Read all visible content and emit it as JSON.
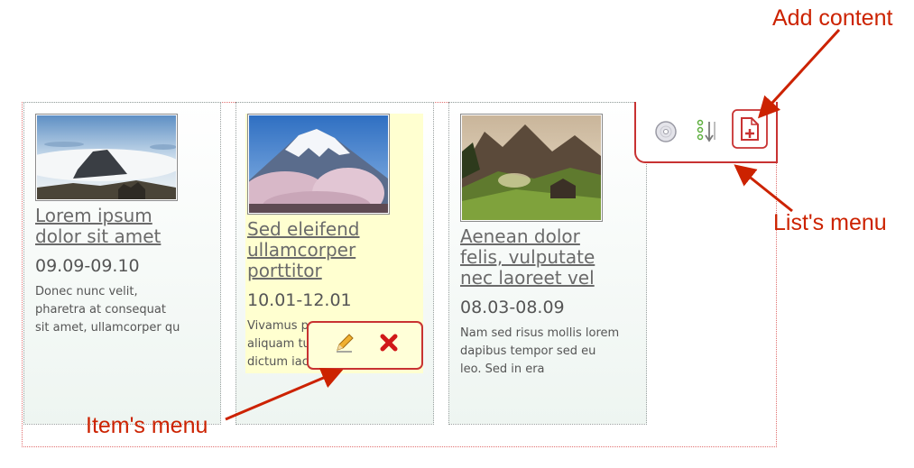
{
  "cards": [
    {
      "title_lines": [
        "Lorem ipsum",
        "dolor sit amet"
      ],
      "date": "09.09-09.10",
      "desc_lines": [
        "Donec nunc velit,",
        "pharetra at consequat",
        "sit amet, ullamcorper qu"
      ],
      "image": "misty-mountain-photo"
    },
    {
      "title_lines": [
        "Sed eleifend",
        "ullamcorper",
        "porttitor"
      ],
      "date": "10.01-12.01",
      "desc_lines": [
        "Vivamus p",
        "aliquam tu",
        "dictum iac"
      ],
      "image": "mount-fuji-cherry-blossom-photo"
    },
    {
      "title_lines": [
        "Aenean dolor",
        "felis, vulputate",
        "nec laoreet vel"
      ],
      "date": "08.03-08.09",
      "desc_lines": [
        "Nam sed risus mollis lorem",
        "dapibus tempor sed eu",
        "leo. Sed in era"
      ],
      "image": "mountain-valley-hut-photo"
    }
  ],
  "item_menu": {
    "icons": [
      "pencil-edit-icon",
      "red-x-delete-icon"
    ]
  },
  "list_menu": {
    "icons": [
      "disc-icon",
      "sort-order-icon",
      "add-page-icon"
    ]
  },
  "annotations": {
    "add_content": "Add content",
    "lists_menu": "List's menu",
    "items_menu": "Item's menu"
  },
  "colors": {
    "annotation": "#cc2200",
    "menu_border": "#c83232",
    "highlight": "#ffffd0",
    "title_text": "#6a6a6a"
  }
}
